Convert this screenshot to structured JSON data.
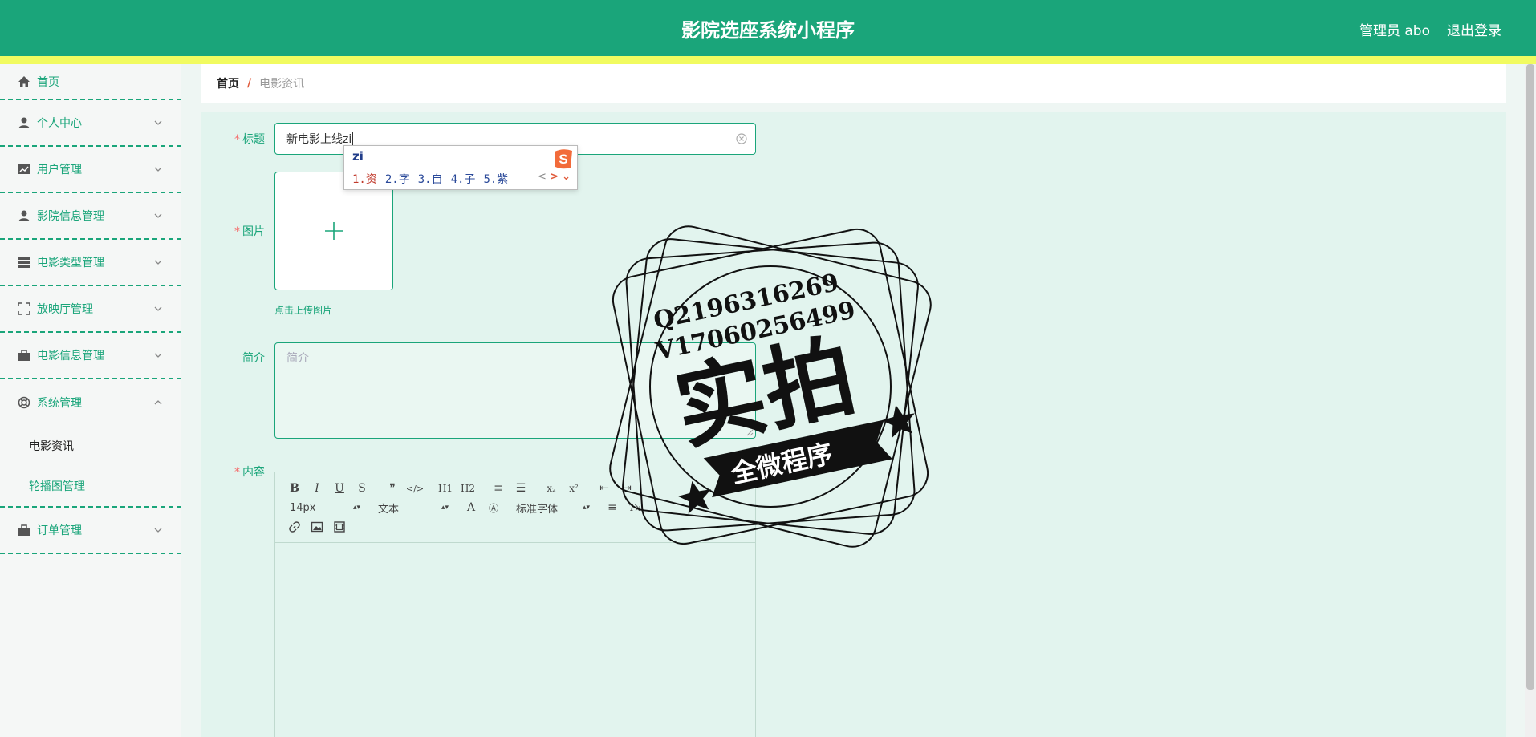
{
  "header": {
    "title": "影院选座系统小程序",
    "user": "管理员 abo",
    "logout": "退出登录",
    "color_primary": "#1aa57a",
    "color_stripe": "#f1fb60"
  },
  "sidebar": {
    "items": [
      {
        "label": "首页",
        "icon": "home-icon"
      },
      {
        "label": "个人中心",
        "icon": "user-icon"
      },
      {
        "label": "用户管理",
        "icon": "chart-icon"
      },
      {
        "label": "影院信息管理",
        "icon": "user-icon"
      },
      {
        "label": "电影类型管理",
        "icon": "grid-icon"
      },
      {
        "label": "放映厅管理",
        "icon": "fullscreen-icon"
      },
      {
        "label": "电影信息管理",
        "icon": "briefcase-icon"
      },
      {
        "label": "系统管理",
        "icon": "lifebuoy-icon"
      },
      {
        "label": "订单管理",
        "icon": "briefcase-icon"
      }
    ],
    "sub_items": [
      {
        "label": "电影资讯",
        "active": true
      },
      {
        "label": "轮播图管理",
        "active": false
      }
    ]
  },
  "breadcrumb": {
    "home": "首页",
    "sep": "/",
    "current": "电影资讯"
  },
  "form": {
    "title_label": "标题",
    "title_value": "新电影上线zi",
    "image_label": "图片",
    "upload_tip": "点击上传图片",
    "intro_label": "简介",
    "intro_placeholder": "简介",
    "content_label": "内容",
    "required_mark": "*"
  },
  "editor": {
    "font_size": "14px",
    "text_style": "文本",
    "font_family": "标准字体",
    "row1": [
      "B",
      "I",
      "U",
      "S",
      "❞",
      "</>",
      "H1",
      "H2",
      "≡",
      "☰",
      "x₂",
      "x²",
      "⇤",
      "⇥"
    ],
    "row2": [
      "A",
      "Ⓐ",
      "≡",
      "Tx"
    ]
  },
  "ime": {
    "composition": "zi",
    "candidates": [
      "1.资",
      "2.字",
      "3.自",
      "4.子",
      "5.紫"
    ],
    "prev": "<",
    "next": ">",
    "expand": "⌄"
  },
  "watermark": {
    "line1": "Q2196316269",
    "line2": "V17060256499",
    "big": "实拍",
    "ribbon": "全微程序"
  }
}
